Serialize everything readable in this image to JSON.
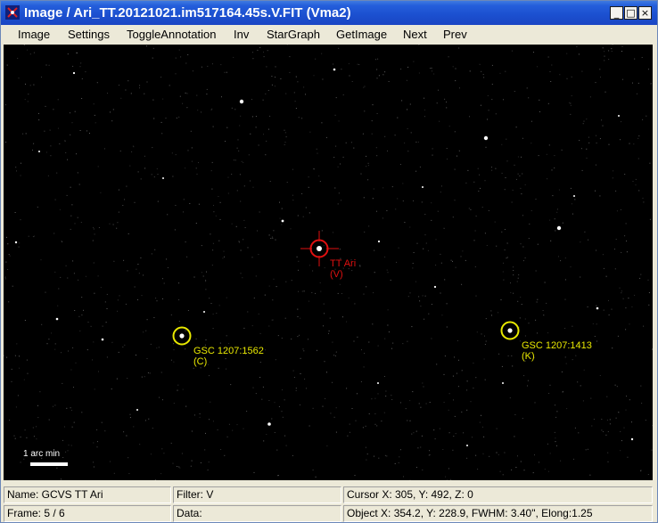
{
  "window": {
    "title": "Image / Ari_TT.20121021.im517164.45s.V.FIT (Vma2)",
    "buttons": [
      "_",
      "□",
      "×"
    ]
  },
  "menu": [
    "Image",
    "Settings",
    "ToggleAnnotation",
    "Inv",
    "StarGraph",
    "GetImage",
    "Next",
    "Prev"
  ],
  "annotations": {
    "variable": {
      "name": "TT Ari",
      "type": "(V)",
      "color": "#e01010"
    },
    "comp": {
      "name": "GSC 1207:1562",
      "type": "(C)",
      "color": "#e8e800"
    },
    "check": {
      "name": "GSC 1207:1413",
      "type": "(K)",
      "color": "#e8e800"
    }
  },
  "scale_bar": {
    "label": "1 arc min"
  },
  "status": {
    "name": "Name: GCVS TT Ari",
    "filter": "Filter: V",
    "cursor": "Cursor X: 305,  Y: 492,  Z: 0",
    "frame": "Frame: 5 / 6",
    "data": "Data:",
    "object": "Object X: 354.2, Y: 228.9, FWHM: 3.40\", Elong:1.25"
  }
}
